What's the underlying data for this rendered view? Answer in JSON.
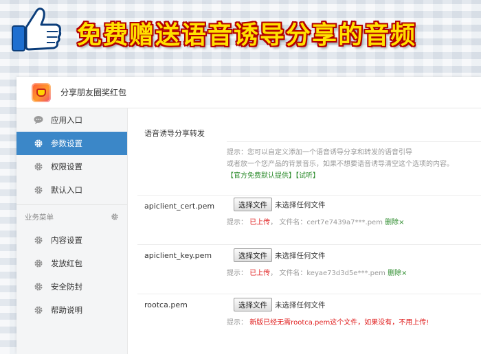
{
  "banner": {
    "title": "免费赠送语音诱导分享的音频"
  },
  "app": {
    "name": "分享朋友圈奖红包"
  },
  "sidebar": {
    "items": [
      {
        "label": "应用入口",
        "icon": "chat-icon",
        "active": false
      },
      {
        "label": "参数设置",
        "icon": "gear-icon",
        "active": true
      },
      {
        "label": "权限设置",
        "icon": "gear-icon",
        "active": false
      },
      {
        "label": "默认入口",
        "icon": "gear-icon",
        "active": false
      }
    ],
    "group_label": "业务菜单",
    "group_items": [
      {
        "label": "内容设置",
        "icon": "gear-icon"
      },
      {
        "label": "发放红包",
        "icon": "gear-icon"
      },
      {
        "label": "安全防封",
        "icon": "gear-icon"
      },
      {
        "label": "帮助说明",
        "icon": "gear-icon"
      }
    ]
  },
  "settings": {
    "voice": {
      "label": "语音诱导分享转发",
      "hint_prefix": "提示：",
      "hint_line1": "您可以自定义添加一个语音诱导分享和转发的语音引导",
      "hint_line2": "或者放一个您产品的背景音乐，如果不想要语音诱导清空这个选项的内容。",
      "link_official": "【官方免费默认提供】",
      "link_try": "【试听】"
    },
    "cert": {
      "label": "apiclient_cert.pem",
      "button": "选择文件",
      "no_file": "未选择任何文件",
      "hint_prefix": "提示：",
      "status": "已上传",
      "sep": "，",
      "filename_label": "文件名：",
      "filename": "cert7e7439a7***.pem",
      "delete": "删除×"
    },
    "key": {
      "label": "apiclient_key.pem",
      "button": "选择文件",
      "no_file": "未选择任何文件",
      "hint_prefix": "提示：",
      "status": "已上传",
      "sep": "，",
      "filename_label": "文件名：",
      "filename": "keyae73d3d5e***.pem",
      "delete": "删除×"
    },
    "rootca": {
      "label": "rootca.pem",
      "button": "选择文件",
      "no_file": "未选择任何文件",
      "hint_prefix": "提示：",
      "warning": "新版已经无需rootca.pem这个文件，如果没有，不用上传!"
    }
  },
  "colors": {
    "active_bg": "#3b87c8",
    "banner_text": "#ffe100",
    "banner_outline": "#b40000",
    "red_text": "#e02020",
    "green_text": "#2a8a2a"
  }
}
